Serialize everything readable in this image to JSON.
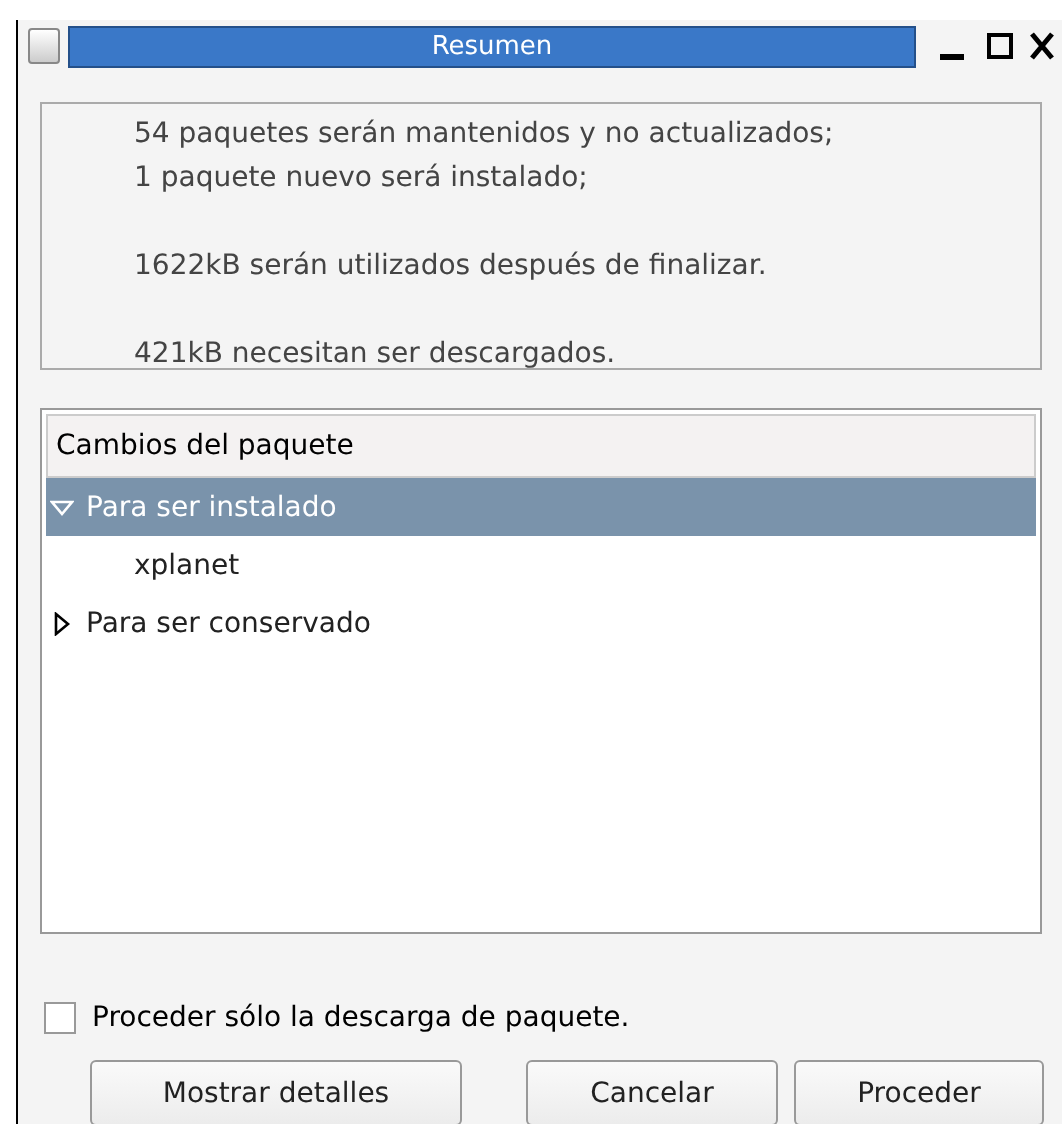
{
  "window": {
    "title": "Resumen"
  },
  "summary": {
    "paragraphs": [
      "54 paquetes serán mantenidos y no actualizados;\n1 paquete nuevo será instalado;",
      "1622kB serán utilizados después de finalizar.",
      "421kB necesitan ser descargados."
    ]
  },
  "tree": {
    "column": "Cambios del paquete",
    "items": [
      {
        "label": "Para ser instalado",
        "expanded": true,
        "selected": true,
        "children": [
          {
            "label": "xplanet",
            "selected": false
          }
        ]
      },
      {
        "label": "Para ser conservado",
        "expanded": false,
        "selected": false
      }
    ]
  },
  "download_only": {
    "label": "Proceder sólo la descarga de paquete.",
    "checked": false
  },
  "buttons": [
    "Mostrar detalles",
    "Cancelar",
    "Proceder"
  ]
}
